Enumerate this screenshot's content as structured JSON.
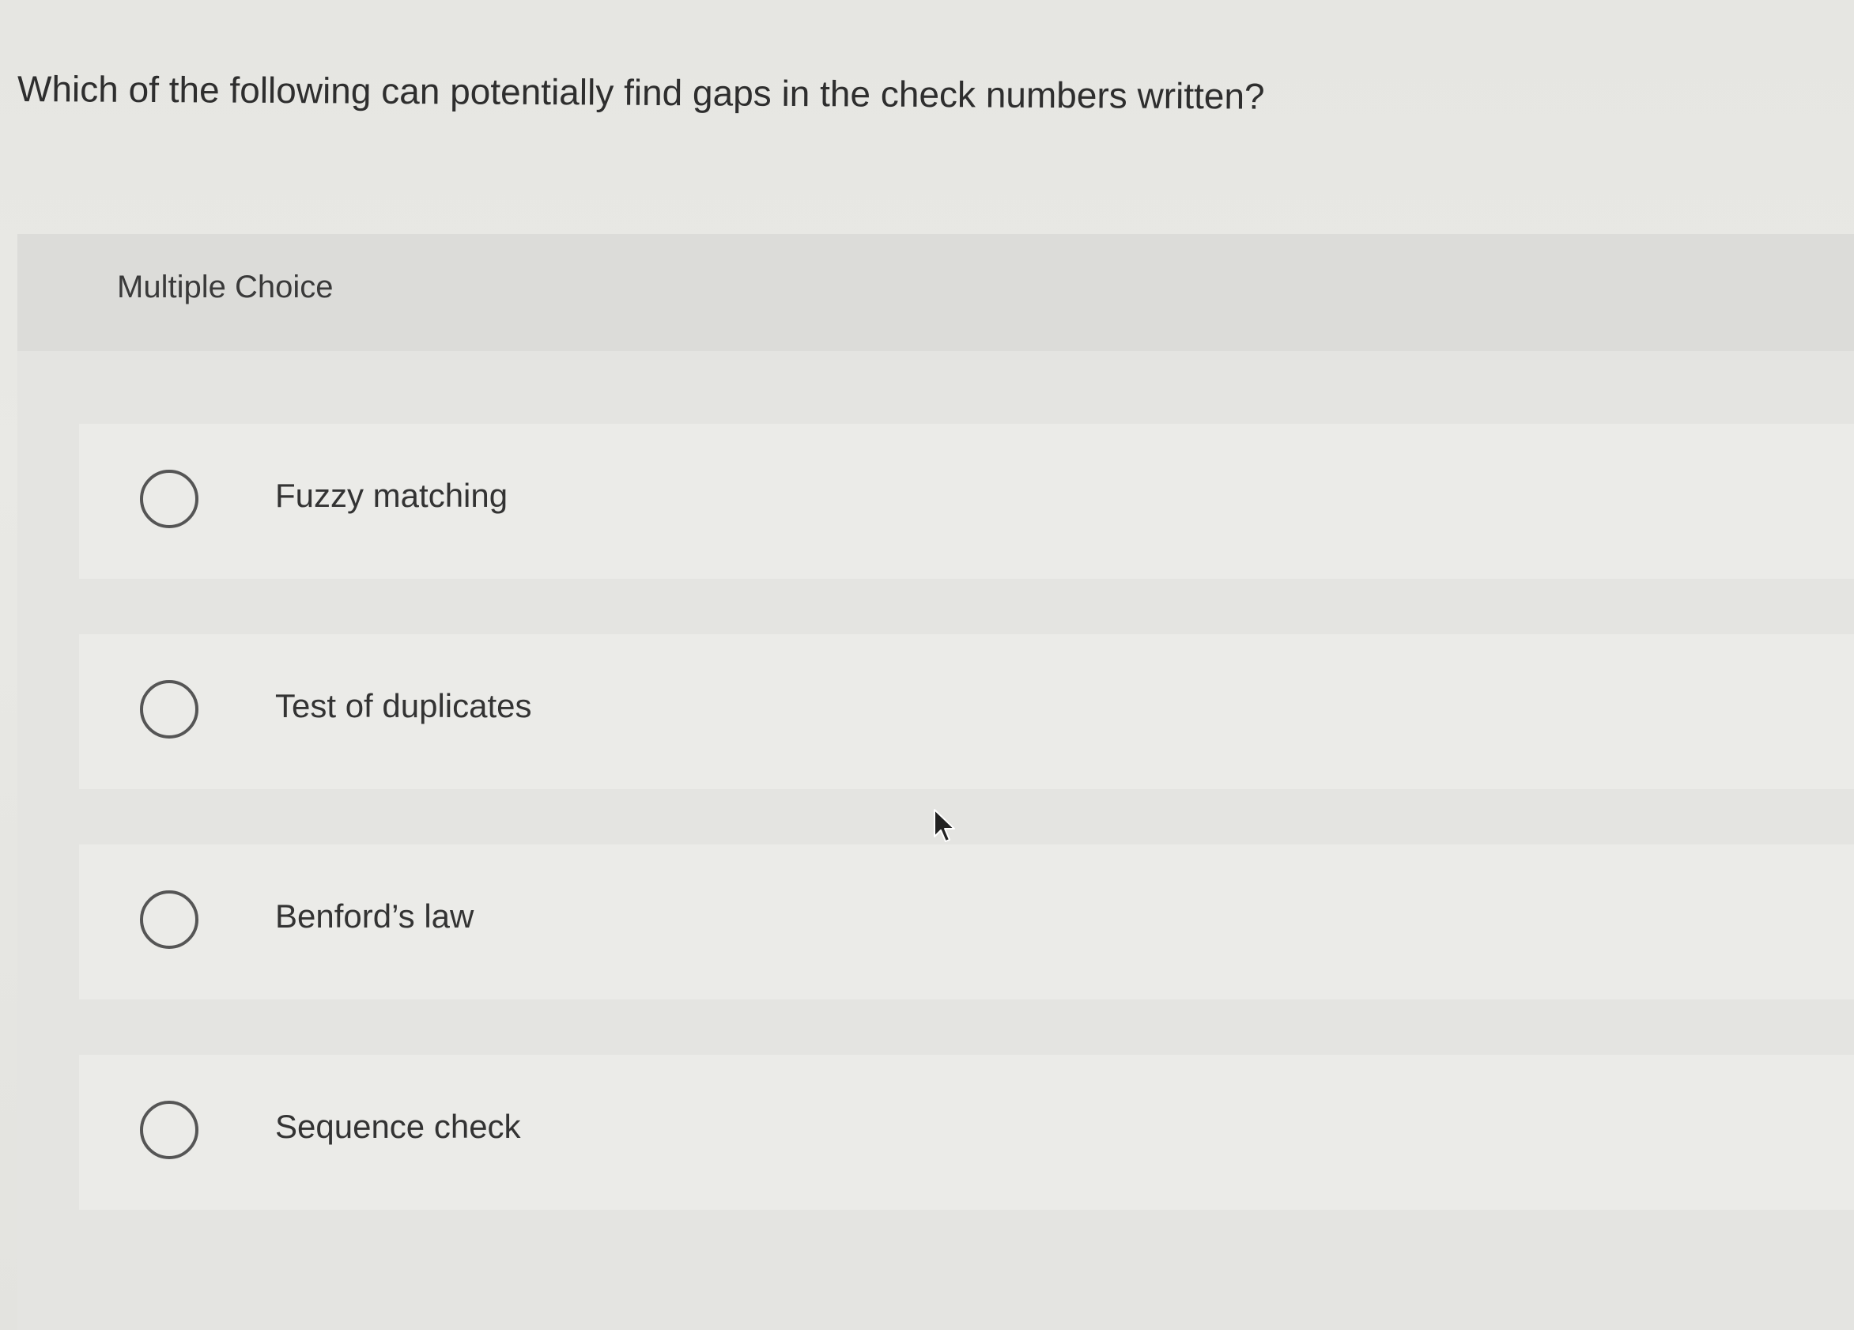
{
  "question": {
    "text": "Which of the following can potentially find gaps in the check numbers written?"
  },
  "multiple_choice": {
    "label": "Multiple Choice",
    "options": [
      {
        "label": "Fuzzy matching",
        "selected": false
      },
      {
        "label": "Test of duplicates",
        "selected": false
      },
      {
        "label": "Benford’s law",
        "selected": false
      },
      {
        "label": "Sequence check",
        "selected": false
      }
    ]
  },
  "icons": {
    "radio": "radio-unselected-icon",
    "cursor": "mouse-pointer-icon"
  },
  "colors": {
    "background": "#e6e6e2",
    "option_background": "#ebebe8",
    "header_background": "#dcdcd9",
    "text": "#2f2f2f",
    "radio_border": "#555555"
  }
}
